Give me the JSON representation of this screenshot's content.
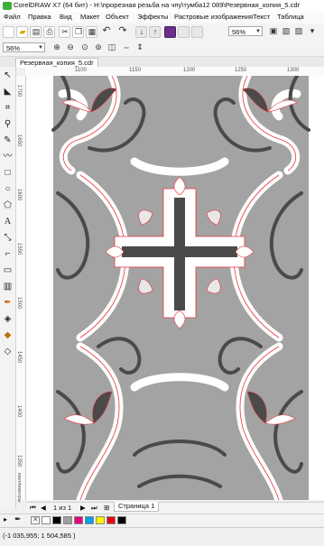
{
  "window": {
    "title": "CorelDRAW X7 (64 бит) - H:\\прорезная резьба на чпу\\тумба12 089\\Резервная_копия_5.cdr"
  },
  "menu": {
    "items": [
      "Файл",
      "Правка",
      "Вид",
      "Макет",
      "Объект",
      "Эффекты",
      "Растровые изображения",
      "Текст",
      "Таблица"
    ]
  },
  "toolbar": {
    "zoom_value": "56%"
  },
  "property_bar": {
    "zoom_value": "56%"
  },
  "document": {
    "tab_label": "Резервная_копия_5.cdr"
  },
  "ruler": {
    "h_labels": [
      "1100",
      "1150",
      "1200",
      "1250",
      "1300"
    ],
    "v_labels": [
      "1700",
      "1650",
      "1600",
      "1550",
      "1500",
      "1450",
      "1400",
      "1350"
    ],
    "units_label": "миллиметры"
  },
  "pages": {
    "counter": "1 из 1",
    "page_tab": "Страница 1"
  },
  "palette": {
    "colors": [
      "#ffffff",
      "#000000",
      "#9e9e9e",
      "#e6007e",
      "#00a0e9",
      "#fff100",
      "#e60012",
      "#000000"
    ]
  },
  "status": {
    "coords": "(-1 035,955; 1 504,585 )"
  },
  "design": {
    "fill_gray": "#a3a3a3",
    "band_white": "#ffffff",
    "stroke_dark": "#4a4a4a",
    "outline_red": "#e8343c"
  }
}
